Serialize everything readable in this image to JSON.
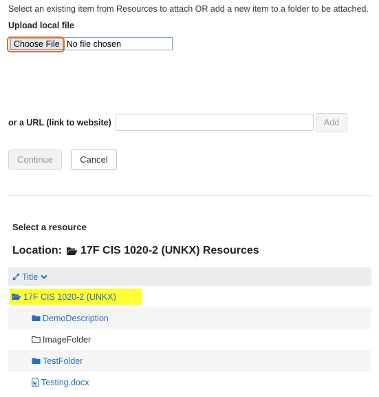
{
  "intro_text": "Select an existing item from Resources to attach OR add a new item to a folder to be attached.",
  "upload": {
    "label": "Upload local file",
    "choose_button": "Choose File",
    "status": "No file chosen"
  },
  "url": {
    "label": "or a URL (link to website)",
    "value": "",
    "add_button": "Add"
  },
  "actions": {
    "continue_label": "Continue",
    "cancel_label": "Cancel"
  },
  "resources": {
    "heading": "Select a resource",
    "location_prefix": "Location:",
    "location_name": "17F CIS 1020-2 (UNKX) Resources",
    "column_title": "Title",
    "root": {
      "label": "17F CIS 1020-2 (UNKX)",
      "icon": "folder-open-icon"
    },
    "items": [
      {
        "label": "DemoDescription",
        "icon": "folder-filled-icon"
      },
      {
        "label": "ImageFolder",
        "icon": "folder-outline-icon"
      },
      {
        "label": "TestFolder",
        "icon": "folder-filled-icon"
      },
      {
        "label": "Testing.docx",
        "icon": "word-document-icon"
      }
    ]
  },
  "colors": {
    "link": "#2a6eb8",
    "highlight_outline": "#d4722f",
    "highlight_fill": "#ffff33"
  }
}
